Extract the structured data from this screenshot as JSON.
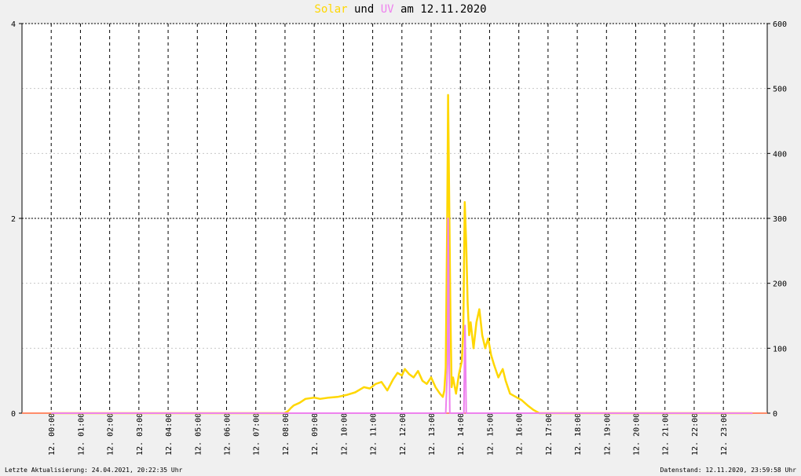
{
  "title": {
    "solar": "Solar",
    "und": " und ",
    "uv": "UV",
    "rest": " am 12.11.2020"
  },
  "footer": {
    "left": "Letzte Aktualisierung: 24.04.2021, 20:22:35 Uhr",
    "right": "Datenstand: 12.11.2020, 23:59:58 Uhr"
  },
  "colors": {
    "solar": "#ffd700",
    "uv": "#ee82ee",
    "baseline": "#ff8c69",
    "background": "#f0f0f0"
  },
  "chart_data": {
    "type": "line",
    "title": "Solar und UV am 12.11.2020",
    "x_unit": "hour",
    "x_tick_labels": [
      "12. 00:00",
      "12. 01:00",
      "12. 02:00",
      "12. 03:00",
      "12. 04:00",
      "12. 05:00",
      "12. 06:00",
      "12. 07:00",
      "12. 08:00",
      "12. 09:00",
      "12. 10:00",
      "12. 11:00",
      "12. 12:00",
      "12. 13:00",
      "12. 14:00",
      "12. 15:00",
      "12. 16:00",
      "12. 17:00",
      "12. 18:00",
      "12. 19:00",
      "12. 20:00",
      "12. 21:00",
      "12. 22:00",
      "12. 23:00"
    ],
    "left_axis": {
      "ylim": [
        0,
        4
      ],
      "ticks": [
        0,
        2,
        4
      ]
    },
    "right_axis": {
      "ylim": [
        0,
        600
      ],
      "ticks": [
        0,
        100,
        200,
        300,
        400,
        500,
        600
      ]
    },
    "grid": true,
    "series": [
      {
        "name": "Solar",
        "axis": "right",
        "x": [
          0,
          7.98,
          8.1,
          8.2,
          8.3,
          8.5,
          8.7,
          9.0,
          9.2,
          9.5,
          9.8,
          10.1,
          10.4,
          10.7,
          10.9,
          11.1,
          11.3,
          11.5,
          11.7,
          11.85,
          12.0,
          12.1,
          12.25,
          12.4,
          12.55,
          12.7,
          12.85,
          13.0,
          13.15,
          13.3,
          13.4,
          13.45,
          13.5,
          13.55,
          13.58,
          13.62,
          13.66,
          13.7,
          13.75,
          13.85,
          13.95,
          14.05,
          14.1,
          14.15,
          14.2,
          14.25,
          14.3,
          14.35,
          14.45,
          14.55,
          14.65,
          14.75,
          14.85,
          14.95,
          15.05,
          15.15,
          15.3,
          15.45,
          15.55,
          15.7,
          15.9,
          16.1,
          16.3,
          16.5,
          16.7,
          16.8,
          24
        ],
        "values": [
          0,
          0,
          3,
          8,
          12,
          16,
          22,
          24,
          22,
          24,
          25,
          28,
          32,
          40,
          38,
          45,
          48,
          35,
          52,
          62,
          58,
          68,
          60,
          55,
          65,
          50,
          45,
          55,
          40,
          30,
          25,
          35,
          70,
          300,
          490,
          320,
          150,
          40,
          55,
          30,
          60,
          80,
          130,
          325,
          260,
          170,
          120,
          140,
          100,
          140,
          160,
          120,
          100,
          115,
          90,
          75,
          55,
          68,
          50,
          30,
          25,
          20,
          12,
          5,
          0,
          0,
          0
        ]
      },
      {
        "name": "UV",
        "axis": "left",
        "x": [
          0,
          13.5,
          13.56,
          13.58,
          13.6,
          13.62,
          13.64,
          13.66,
          14.12,
          14.14,
          14.16,
          14.18,
          14.2,
          24
        ],
        "values": [
          0,
          0,
          0.5,
          2.0,
          1.5,
          0.5,
          0.0,
          0,
          0,
          0.5,
          0.9,
          0.5,
          0,
          0
        ]
      }
    ]
  }
}
